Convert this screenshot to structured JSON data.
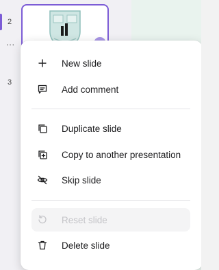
{
  "slide_strip": {
    "slides": [
      {
        "number": "2"
      },
      {
        "number": "3"
      }
    ],
    "more_label": "..."
  },
  "context_menu": {
    "items": [
      {
        "label": "New slide",
        "icon": "plus-icon",
        "disabled": false
      },
      {
        "label": "Add comment",
        "icon": "comment-icon",
        "disabled": false
      },
      {
        "label": "Duplicate slide",
        "icon": "duplicate-icon",
        "disabled": false
      },
      {
        "label": "Copy to another presentation",
        "icon": "copy-to-presentation-icon",
        "disabled": false
      },
      {
        "label": "Skip slide",
        "icon": "eye-off-icon",
        "disabled": false
      },
      {
        "label": "Reset slide",
        "icon": "reset-icon",
        "disabled": true
      },
      {
        "label": "Delete slide",
        "icon": "trash-icon",
        "disabled": false
      }
    ]
  },
  "colors": {
    "accent": "#7c5cd6",
    "disabled_text": "#c4c4c8",
    "disabled_bg": "#f4f4f5"
  }
}
